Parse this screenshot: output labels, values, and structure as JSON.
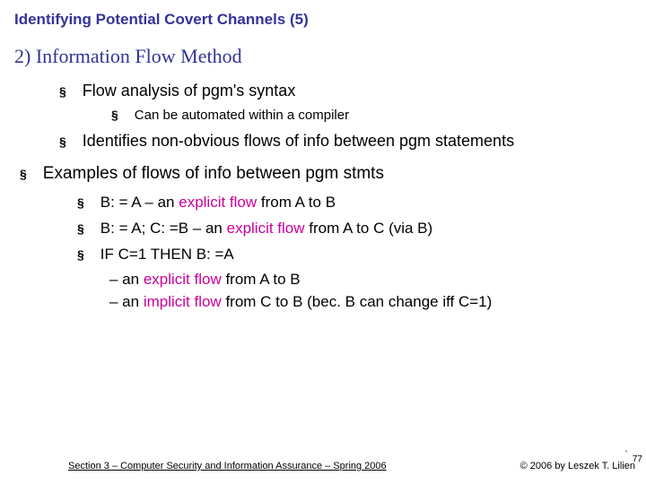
{
  "title": "Identifying Potential Covert Channels (5)",
  "heading": "2) Information Flow Method",
  "items": {
    "lv1a": "Flow analysis of pgm's syntax",
    "lv2a": "Can be automated within a compiler",
    "lv1b": "Identifies non-obvious flows of info between pgm statements",
    "lv0a": "Examples of flows of info between pgm stmts",
    "ex1_pre": "B: = A   – an ",
    "ex1_mag": "explicit flow",
    "ex1_post": " from A to B",
    "ex2_pre": "B: = A; C: =B   – an ",
    "ex2_mag": "explicit flow",
    "ex2_post": " from A to C (via B)",
    "ex3": "IF C=1 THEN B: =A",
    "sub1_pre": "– an ",
    "sub1_mag": "explicit flow",
    "sub1_post": " from A to B",
    "sub2_pre": "– an ",
    "sub2_mag": "implicit flow",
    "sub2_post": " from C to B (bec. B can change iff C=1)"
  },
  "footer": {
    "left": "Section 3 – Computer Security and Information Assurance – Spring 2006",
    "right": "© 2006 by Leszek T. Lilien"
  },
  "page": "77",
  "bullet": "§"
}
